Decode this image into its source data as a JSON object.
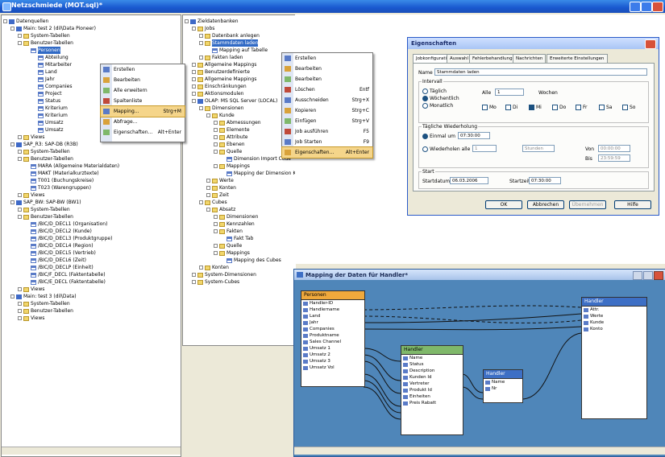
{
  "window": {
    "title": "Netzschmiede (MOT.sql)*"
  },
  "left_tree": {
    "items": [
      {
        "label": "Datenquellen",
        "d": 0,
        "icon": "db"
      },
      {
        "label": "Main: test 2 (dil\\Data Pioneer)",
        "d": 1,
        "icon": "db"
      },
      {
        "label": "System-Tabellen",
        "d": 2,
        "icon": "folder"
      },
      {
        "label": "Benutzer-Tabellen",
        "d": 2,
        "icon": "folder"
      },
      {
        "label": "Personen",
        "d": 3,
        "icon": "tbl",
        "selected": true
      },
      {
        "label": "Abteilung",
        "d": 4,
        "icon": "tbl"
      },
      {
        "label": "Mitarbeiter",
        "d": 4,
        "icon": "tbl"
      },
      {
        "label": "Land",
        "d": 4,
        "icon": "tbl"
      },
      {
        "label": "Jahr",
        "d": 4,
        "icon": "tbl"
      },
      {
        "label": "Companies",
        "d": 4,
        "icon": "tbl"
      },
      {
        "label": "Project",
        "d": 4,
        "icon": "tbl"
      },
      {
        "label": "Status",
        "d": 4,
        "icon": "tbl"
      },
      {
        "label": "Kriterium",
        "d": 4,
        "icon": "tbl"
      },
      {
        "label": "Kriterium",
        "d": 4,
        "icon": "tbl"
      },
      {
        "label": "Umsatz",
        "d": 4,
        "icon": "tbl"
      },
      {
        "label": "Umsatz",
        "d": 4,
        "icon": "tbl"
      },
      {
        "label": "Views",
        "d": 2,
        "icon": "folder"
      },
      {
        "label": "SAP_R3: SAP-DB (R3B)",
        "d": 1,
        "icon": "db"
      },
      {
        "label": "System-Tabellen",
        "d": 2,
        "icon": "folder"
      },
      {
        "label": "Benutzer-Tabellen",
        "d": 2,
        "icon": "folder"
      },
      {
        "label": "MARA (Allgemeine Materialdaten)",
        "d": 3,
        "icon": "tbl"
      },
      {
        "label": "MAKT (Materialkurztexte)",
        "d": 3,
        "icon": "tbl"
      },
      {
        "label": "T001 (Buchungskreise)",
        "d": 3,
        "icon": "tbl"
      },
      {
        "label": "T023 (Warengruppen)",
        "d": 3,
        "icon": "tbl"
      },
      {
        "label": "Views",
        "d": 2,
        "icon": "folder"
      },
      {
        "label": "SAP_BW: SAP-BW (BW1)",
        "d": 1,
        "icon": "db"
      },
      {
        "label": "System-Tabellen",
        "d": 2,
        "icon": "folder"
      },
      {
        "label": "Benutzer-Tabellen",
        "d": 2,
        "icon": "folder"
      },
      {
        "label": "/BIC/D_DECL1 (Organisation)",
        "d": 3,
        "icon": "tbl"
      },
      {
        "label": "/BIC/D_DECL2 (Kunde)",
        "d": 3,
        "icon": "tbl"
      },
      {
        "label": "/BIC/D_DECL3 (Produktgruppe)",
        "d": 3,
        "icon": "tbl"
      },
      {
        "label": "/BIC/D_DECL4 (Region)",
        "d": 3,
        "icon": "tbl"
      },
      {
        "label": "/BIC/D_DECL5 (Vertrieb)",
        "d": 3,
        "icon": "tbl"
      },
      {
        "label": "/BIC/D_DECL6 (Zeit)",
        "d": 3,
        "icon": "tbl"
      },
      {
        "label": "/BIC/D_DECLP (Einheit)",
        "d": 3,
        "icon": "tbl"
      },
      {
        "label": "/BIC/F_DECL (Faktentabelle)",
        "d": 3,
        "icon": "tbl"
      },
      {
        "label": "/BIC/E_DECL (Faktentabelle)",
        "d": 3,
        "icon": "tbl"
      },
      {
        "label": "Views",
        "d": 2,
        "icon": "folder"
      },
      {
        "label": "Main: test 3 (dil\\Data)",
        "d": 1,
        "icon": "db"
      },
      {
        "label": "System-Tabellen",
        "d": 2,
        "icon": "folder"
      },
      {
        "label": "Benutzer-Tabellen",
        "d": 2,
        "icon": "folder"
      },
      {
        "label": "Views",
        "d": 2,
        "icon": "folder"
      }
    ]
  },
  "context_menu_1": {
    "items": [
      {
        "label": "Erstellen",
        "shortcut": ""
      },
      {
        "label": "Bearbeiten",
        "shortcut": ""
      },
      {
        "label": "Alle erweitern",
        "shortcut": ""
      },
      {
        "label": "Spaltenliste",
        "shortcut": ""
      },
      {
        "label": "Mapping...",
        "shortcut": "Strg+M",
        "highlight": true
      },
      {
        "label": "Abfrage...",
        "shortcut": ""
      },
      {
        "label": "Eigenschaften...",
        "shortcut": "Alt+Enter"
      }
    ]
  },
  "middle_tree": {
    "items": [
      {
        "label": "Zieldatenbanken",
        "d": 0,
        "icon": "db"
      },
      {
        "label": "Jobs",
        "d": 1,
        "icon": "folder"
      },
      {
        "label": "Datenbank anlegen",
        "d": 2,
        "icon": "folder"
      },
      {
        "label": "Stammdaten laden",
        "d": 2,
        "icon": "folder",
        "selected": true
      },
      {
        "label": "Mapping auf Tabelle",
        "d": 3,
        "icon": "tbl"
      },
      {
        "label": "Fakten laden",
        "d": 2,
        "icon": "folder"
      },
      {
        "label": "Allgemeine Mappings",
        "d": 1,
        "icon": "folder"
      },
      {
        "label": "Benutzerdefinierte",
        "d": 1,
        "icon": "folder"
      },
      {
        "label": "Allgemeine Mappings",
        "d": 1,
        "icon": "folder"
      },
      {
        "label": "Einschränkungen",
        "d": 1,
        "icon": "folder"
      },
      {
        "label": "Aktionsmodulen",
        "d": 1,
        "icon": "folder"
      },
      {
        "label": "OLAP: MS SQL Server (LOCAL)",
        "d": 1,
        "icon": "db"
      },
      {
        "label": "Dimensionen",
        "d": 2,
        "icon": "folder"
      },
      {
        "label": "Kunde",
        "d": 3,
        "icon": "folder"
      },
      {
        "label": "Abmessungen",
        "d": 4,
        "icon": "folder"
      },
      {
        "label": "Elemente",
        "d": 4,
        "icon": "folder"
      },
      {
        "label": "Attribute",
        "d": 4,
        "icon": "folder"
      },
      {
        "label": "Ebenen",
        "d": 4,
        "icon": "folder"
      },
      {
        "label": "Quelle",
        "d": 4,
        "icon": "folder"
      },
      {
        "label": "Dimension Import Code",
        "d": 5,
        "icon": "tbl"
      },
      {
        "label": "Mappings",
        "d": 4,
        "icon": "folder"
      },
      {
        "label": "Mapping der Dimension Kunde",
        "d": 5,
        "icon": "tbl"
      },
      {
        "label": "Werte",
        "d": 3,
        "icon": "folder"
      },
      {
        "label": "Konten",
        "d": 3,
        "icon": "folder"
      },
      {
        "label": "Zeit",
        "d": 3,
        "icon": "folder"
      },
      {
        "label": "Cubes",
        "d": 2,
        "icon": "folder"
      },
      {
        "label": "Absatz",
        "d": 3,
        "icon": "folder"
      },
      {
        "label": "Dimensionen",
        "d": 4,
        "icon": "folder"
      },
      {
        "label": "Kennzahlen",
        "d": 4,
        "icon": "folder"
      },
      {
        "label": "Fakten",
        "d": 4,
        "icon": "folder"
      },
      {
        "label": "Fakt Tab",
        "d": 5,
        "icon": "tbl"
      },
      {
        "label": "Quelle",
        "d": 4,
        "icon": "folder"
      },
      {
        "label": "Mappings",
        "d": 4,
        "icon": "folder"
      },
      {
        "label": "Mapping des Cubes",
        "d": 5,
        "icon": "tbl"
      },
      {
        "label": "Konten",
        "d": 2,
        "icon": "folder"
      },
      {
        "label": "System-Dimensionen",
        "d": 1,
        "icon": "folder"
      },
      {
        "label": "System-Cubes",
        "d": 1,
        "icon": "folder"
      }
    ]
  },
  "context_menu_2": {
    "items": [
      {
        "label": "Erstellen",
        "shortcut": ""
      },
      {
        "label": "Bearbeiten",
        "shortcut": ""
      },
      {
        "label": "Bearbeiten",
        "shortcut": ""
      },
      {
        "label": "Löschen",
        "shortcut": "Entf"
      },
      {
        "label": "Ausschneiden",
        "shortcut": "Strg+X"
      },
      {
        "label": "Kopieren",
        "shortcut": "Strg+C"
      },
      {
        "label": "Einfügen",
        "shortcut": "Strg+V"
      },
      {
        "label": "Job ausführen",
        "shortcut": "F5"
      },
      {
        "label": "Job Starten",
        "shortcut": "F9"
      },
      {
        "label": "Eigenschaften...",
        "shortcut": "Alt+Enter",
        "highlight": true
      }
    ]
  },
  "dialog": {
    "title": "Eigenschaften",
    "tabs": [
      "Jobkonfiguration",
      "Auswahl",
      "Fehlerbehandlung",
      "Nachrichten",
      "Erweiterte Einstellungen"
    ],
    "name_label": "Name",
    "name_value": "Stammdaten laden",
    "interval_group": "Intervall",
    "radio_labels": [
      "Täglich",
      "Wöchentlich",
      "Monatlich"
    ],
    "every_label": "Alle",
    "every_value": "1",
    "weeks_label": "Wochen",
    "days": [
      "Mo",
      "Di",
      "Mi",
      "Do",
      "Fr",
      "Sa",
      "So"
    ],
    "daily_freq_label": "Tägliche Wiederholung",
    "once_label": "Einmal um",
    "once_value": "07:30:00",
    "repeat_label": "Wiederholen alle",
    "repeat_value": "1",
    "repeat_unit": "Stunden",
    "from_label": "Von",
    "from_value": "00:00:00",
    "to_label": "Bis",
    "to_value": "23:59:59",
    "start_group": "Start",
    "start_date_label": "Startdatum",
    "start_date_value": "06.03.2006",
    "start_time_label": "Startzeit",
    "start_time_value": "07:30:00",
    "buttons": [
      "OK",
      "Abbrechen",
      "Übernehmen",
      "Hilfe"
    ]
  },
  "mapping_window": {
    "title": "Mapping der Daten für Handler*",
    "source_box": {
      "title": "Personen",
      "items": [
        "Handler-ID",
        "Handlername",
        "Land",
        "Jahr",
        "Companies",
        "Produktname",
        "Sales Channel",
        "Umsatz 1",
        "Umsatz 2",
        "Umsatz 3",
        "Umsatz Vol"
      ]
    },
    "middle_box": {
      "title": "Handler",
      "items": [
        "Name",
        "Status",
        "Description",
        "Kunden Id",
        "Vertreter",
        "Produkt Id",
        "Einheiten",
        "Preis Rabatt"
      ]
    },
    "small_box": {
      "title": "Handler",
      "items": [
        "Name",
        "Nr"
      ]
    },
    "target_box": {
      "title": "Handler",
      "items": [
        "Attr.",
        "Werte",
        "Kunde",
        "Konto"
      ]
    }
  }
}
